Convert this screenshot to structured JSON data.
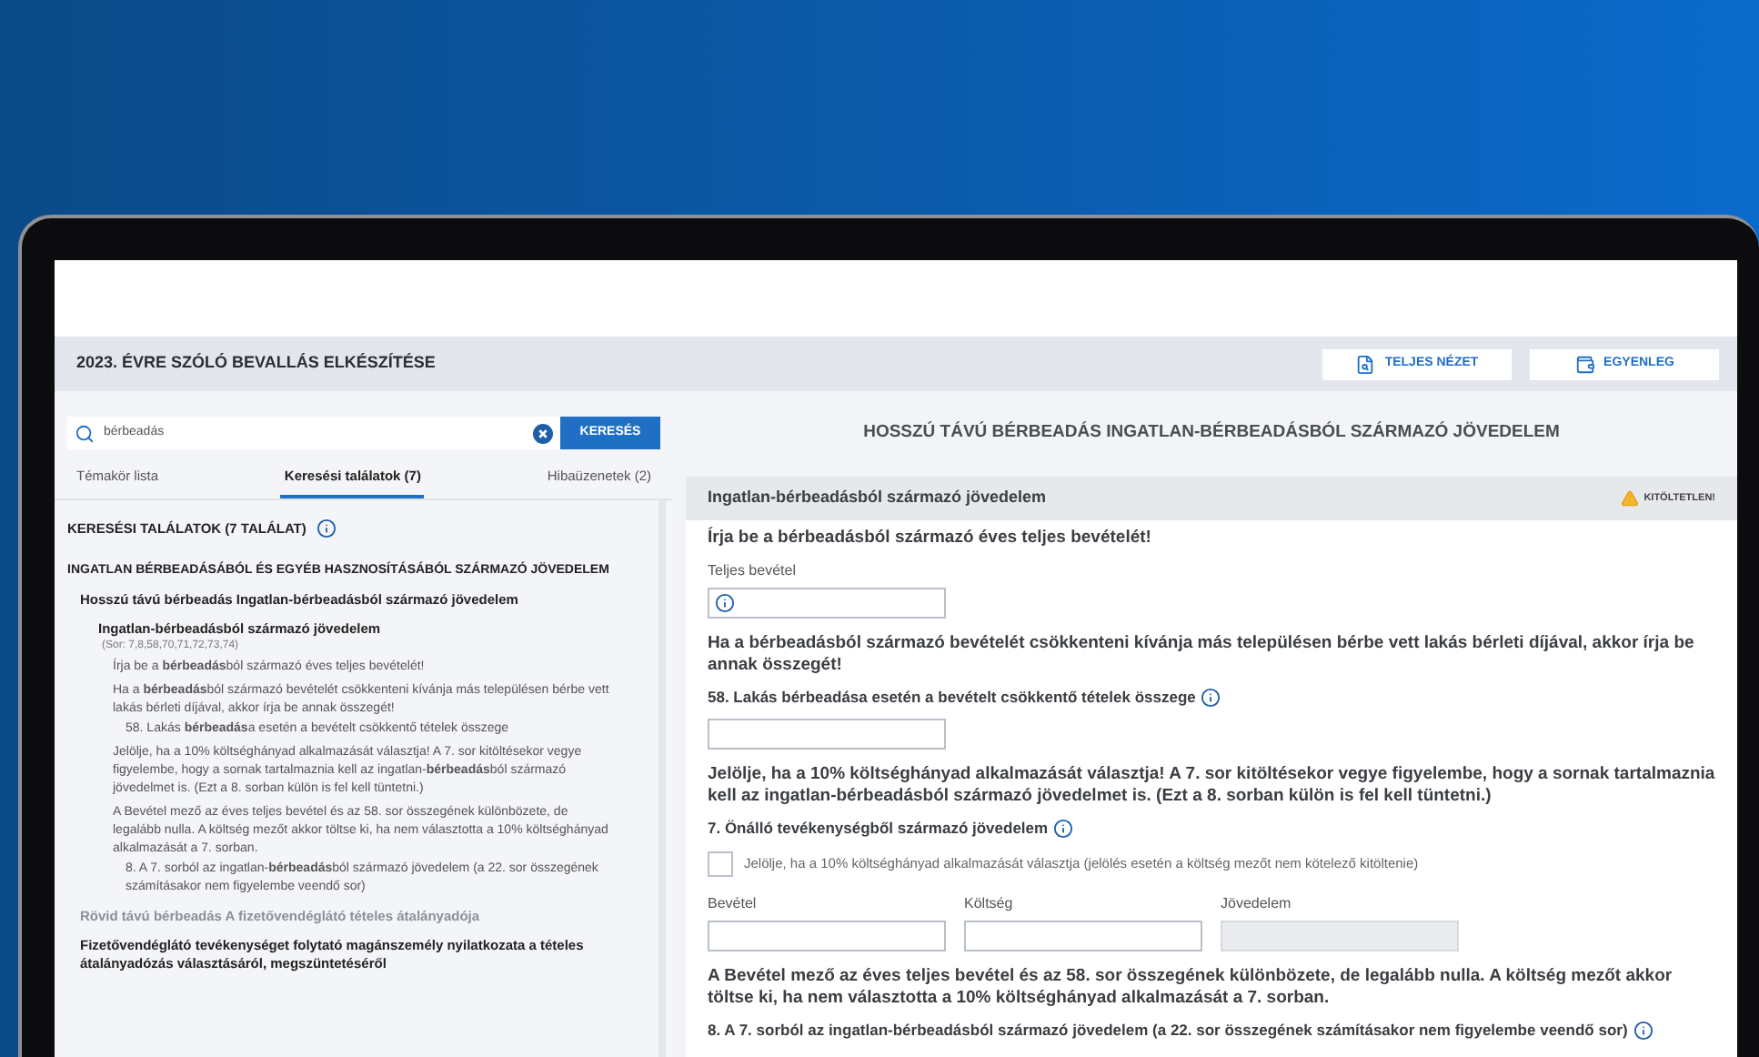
{
  "header": {
    "title": "2023. ÉVRE SZÓLÓ BEVALLÁS ELKÉSZÍTÉSE",
    "buttons": [
      "TELJES NÉZET",
      "EGYENLEG"
    ]
  },
  "search": {
    "value": "bérbeadás",
    "button": "KERESÉS"
  },
  "tabs": [
    {
      "label": "Témakör lista",
      "selected": false
    },
    {
      "label": "Keresési találatok (7)",
      "selected": true
    },
    {
      "label": "Hibaüzenetek (2)",
      "selected": false
    }
  ],
  "results": {
    "title": "KERESÉSI TALÁLATOK (7 TALÁLAT)",
    "items": [
      {
        "text": "INGATLAN **BÉRBEADÁS**ÁBÓL ÉS EGYÉB HASZNOSÍTÁSÁBÓL SZÁRMAZÓ JÖVEDELEM",
        "dimmed": false,
        "children": [
          {
            "text": "Hosszú távú **bérbeadás** Ingatlan-**bérbeadás**ból származó jövedelem",
            "dimmed": false,
            "children": [
              {
                "text": "Ingatlan-**bérbeadás**ból származó jövedelem",
                "rows": "(Sor: 7,8,58,70,71,72,73,74)",
                "dimmed": false,
                "children": [
                  {
                    "text": "Írja be a **bérbeadás**ból származó éves teljes bevételét!",
                    "dimmed": false
                  },
                  {
                    "text": "Ha a **bérbeadás**ból származó bevételét csökkenteni kívánja más településen bérbe vett lakás bérleti díjával, akkor írja be annak összegét!",
                    "dimmed": false,
                    "children": [
                      {
                        "text": "58. Lakás **bérbeadás**a esetén a bevételt csökkentő tételek összege",
                        "dimmed": false
                      }
                    ]
                  },
                  {
                    "text": "Jelölje, ha a 10% költséghányad alkalmazását választja! A 7. sor kitöltésekor vegye figyelembe, hogy a sornak tartalmaznia kell az ingatlan-**bérbeadás**ból származó jövedelmet is. (Ezt a 8. sorban külön is fel kell tüntetni.)",
                    "dimmed": false
                  },
                  {
                    "text": "A Bevétel mező az éves teljes bevétel és az 58. sor összegének különbözete, de legalább nulla. A költség mezőt akkor töltse ki, ha nem választotta a 10% költséghányad alkalmazását a 7. sorban.",
                    "dimmed": false,
                    "children": [
                      {
                        "text": "8. A 7. sorból az ingatlan-**bérbeadás**ból származó jövedelem (a 22. sor összegének számításakor nem figyelembe veendő sor)",
                        "dimmed": false
                      }
                    ]
                  }
                ]
              }
            ]
          },
          {
            "text": "Rövid távú **bérbeadás** A fizetővendéglátó tételes átalányadója",
            "dimmed": true
          },
          {
            "text": "Fizetővendéglátó tevékenységet folytató magánszemély nyilatkozata a tételes átalányadózás választásáról, megszüntetéséről",
            "dimmed": false
          }
        ]
      }
    ]
  },
  "page_title": "HOSSZÚ TÁVÚ BÉRBEADÁS INGATLAN-BÉRBEADÁSBÓL SZÁRMAZÓ JÖVEDELEM",
  "section": {
    "title": "Ingatlan-bérbeadásból származó jövedelem",
    "status": "KITÖLTETLEN!",
    "form": [
      {
        "kind": "prompt",
        "text": "Írja be a bérbeadásból származó éves teljes bevételét!"
      },
      {
        "kind": "field",
        "label": "Teljes bevétel",
        "info": true
      },
      {
        "kind": "prompt",
        "text": "Ha a bérbeadásból származó bevételét csökkenteni kívánja más településen bérbe vett lakás bérleti díjával, akkor írja be annak összegét!"
      },
      {
        "kind": "heading",
        "text": "58. Lakás bérbeadása esetén a bevételt csökkentő tételek összege",
        "info": true
      },
      {
        "kind": "field"
      },
      {
        "kind": "prompt",
        "text": "Jelölje, ha a 10% költséghányad alkalmazását választja! A 7. sor kitöltésekor vegye figyelembe, hogy a sornak tartalmaznia kell az ingatlan-bérbeadásból származó jövedelmet is. (Ezt a 8. sorban külön is fel kell tüntetni.)"
      },
      {
        "kind": "heading",
        "text": "7. Önálló tevékenységből származó jövedelem",
        "info": true
      },
      {
        "kind": "checkbox",
        "checked": false,
        "label": "Jelölje, ha a 10% költséghányad alkalmazását választja (jelölés esetén a költség mezőt nem kötelező kitöltenie)"
      },
      {
        "kind": "fields",
        "fields": [
          {
            "label": "Bevétel",
            "disabled": false
          },
          {
            "label": "Költség",
            "disabled": false
          },
          {
            "label": "Jövedelem",
            "disabled": true
          }
        ]
      },
      {
        "kind": "prompt",
        "text": "A Bevétel mező az éves teljes bevétel és az 58. sor összegének különbözete, de legalább nulla. A költség mezőt akkor töltse ki, ha nem választotta a 10% költséghányad alkalmazását a 7. sorban."
      },
      {
        "kind": "heading",
        "text": "8. A 7. sorból az ingatlan-bérbeadásból származó jövedelem (a 22. sor összegének számításakor nem figyelembe veendő sor)",
        "info": true
      }
    ]
  }
}
